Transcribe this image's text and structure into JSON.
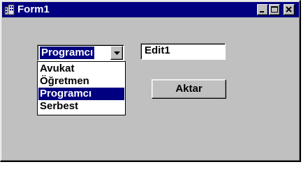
{
  "window": {
    "title": "Form1"
  },
  "combo": {
    "value": "Programcı",
    "options": [
      "Avukat",
      "Öğretmen",
      "Programcı",
      "Serbest"
    ],
    "selected_index": 2
  },
  "edit": {
    "value": "Edit1"
  },
  "button": {
    "label": "Aktar"
  },
  "colors": {
    "titlebar": "#000080",
    "face": "#c0c0c0",
    "selection": "#000080"
  },
  "icons": {
    "app": "building-icon",
    "minimize": "minimize-icon",
    "maximize": "maximize-icon",
    "close": "close-icon",
    "dropdown_arrow": "chevron-down-icon"
  }
}
